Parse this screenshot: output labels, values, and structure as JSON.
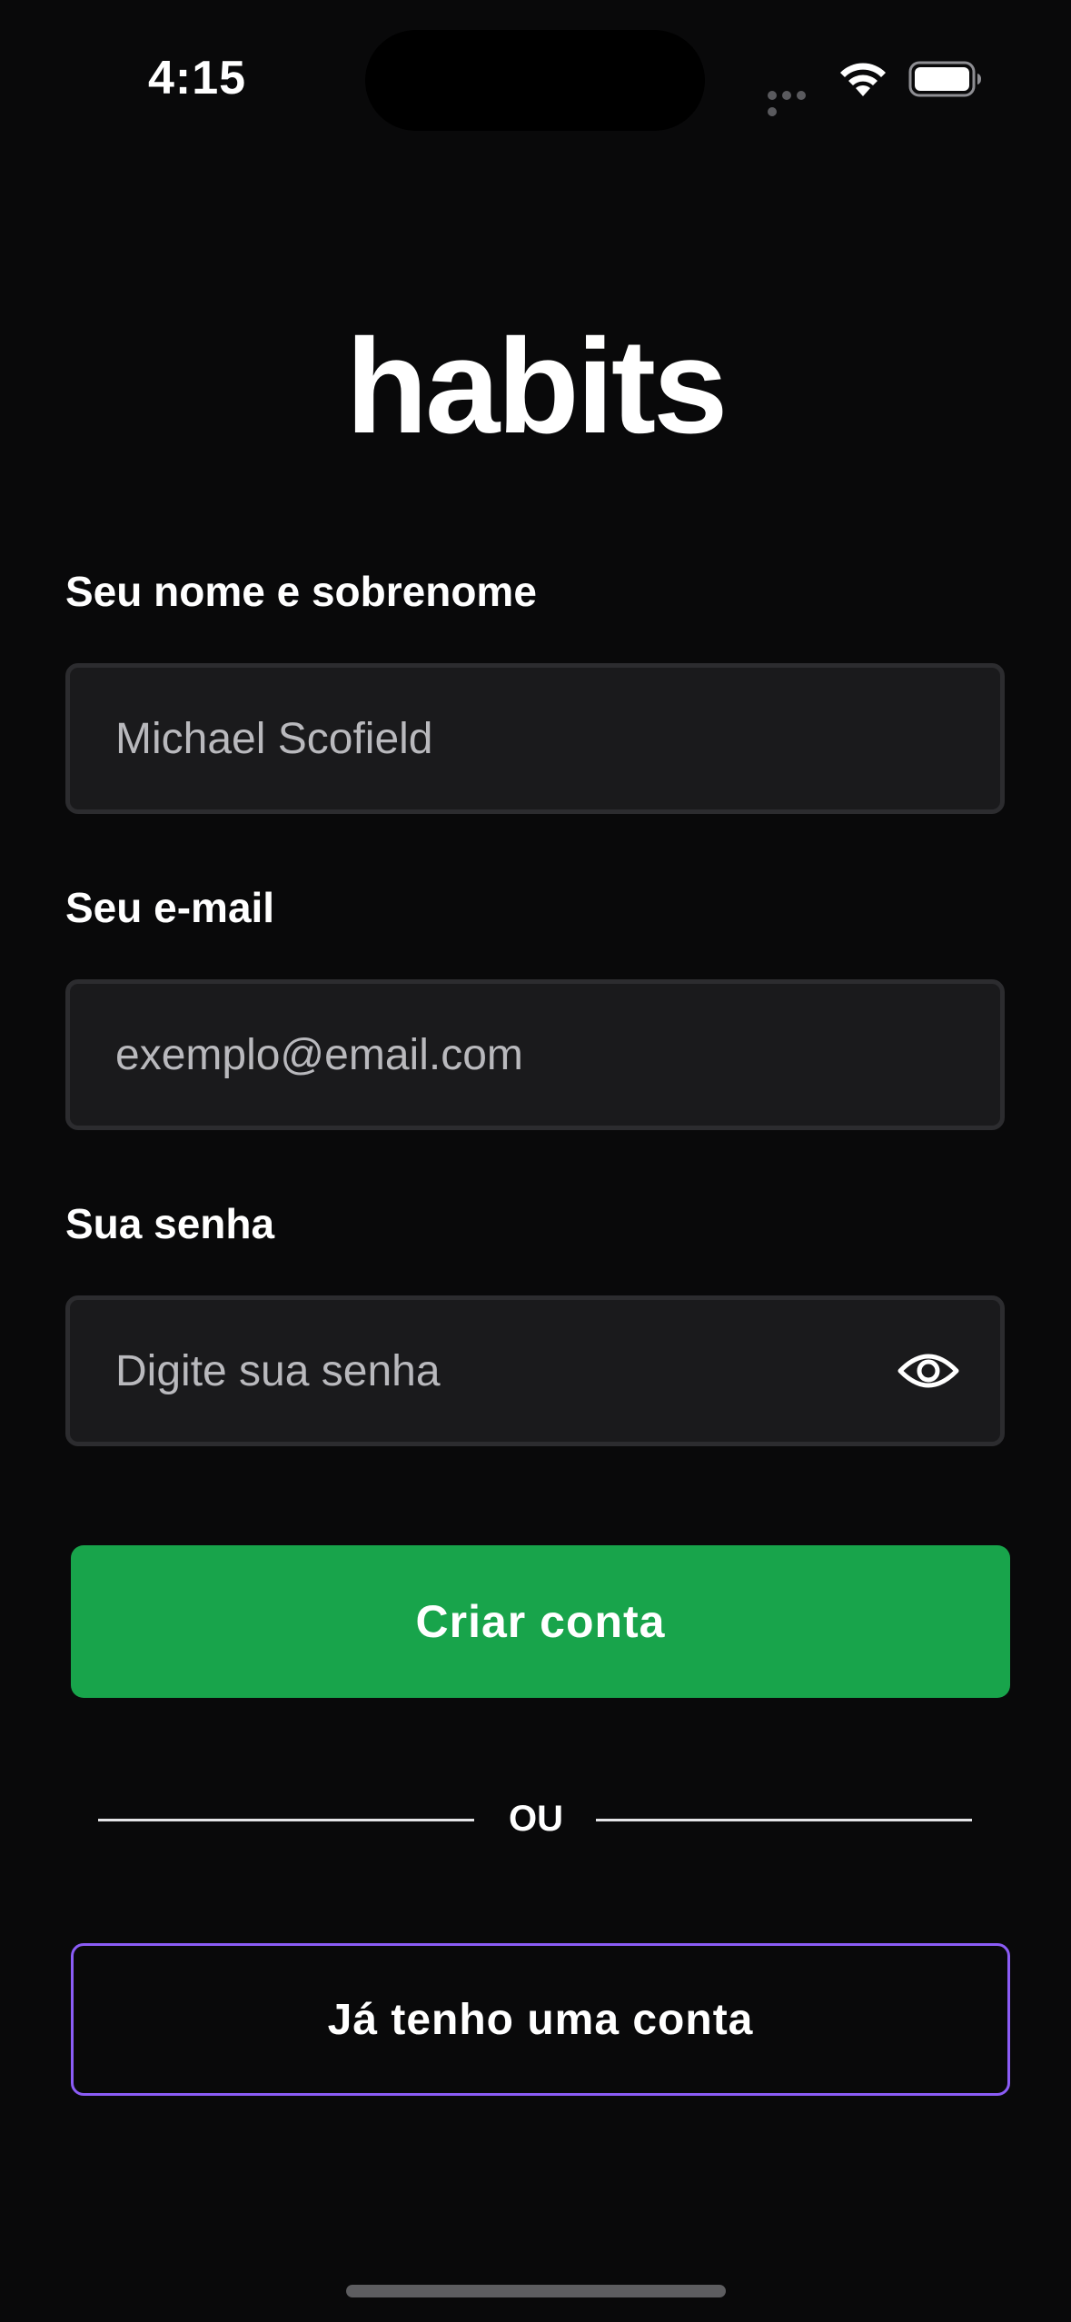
{
  "status_bar": {
    "time": "4:15"
  },
  "app": {
    "logo": "habits"
  },
  "form": {
    "name": {
      "label": "Seu nome e sobrenome",
      "value": "Michael Scofield",
      "placeholder": ""
    },
    "email": {
      "label": "Seu e-mail",
      "value": "",
      "placeholder": "exemplo@email.com"
    },
    "password": {
      "label": "Sua senha",
      "value": "",
      "placeholder": "Digite sua senha",
      "toggle_icon": "eye-icon"
    }
  },
  "actions": {
    "create_account": "Criar conta",
    "divider": "OU",
    "have_account": "Já tenho uma conta"
  },
  "colors": {
    "background": "#09090a",
    "field_background": "#1a1a1c",
    "field_border": "#2c2c2f",
    "primary_button": "#18a44b",
    "secondary_border": "#8b5cf6"
  }
}
